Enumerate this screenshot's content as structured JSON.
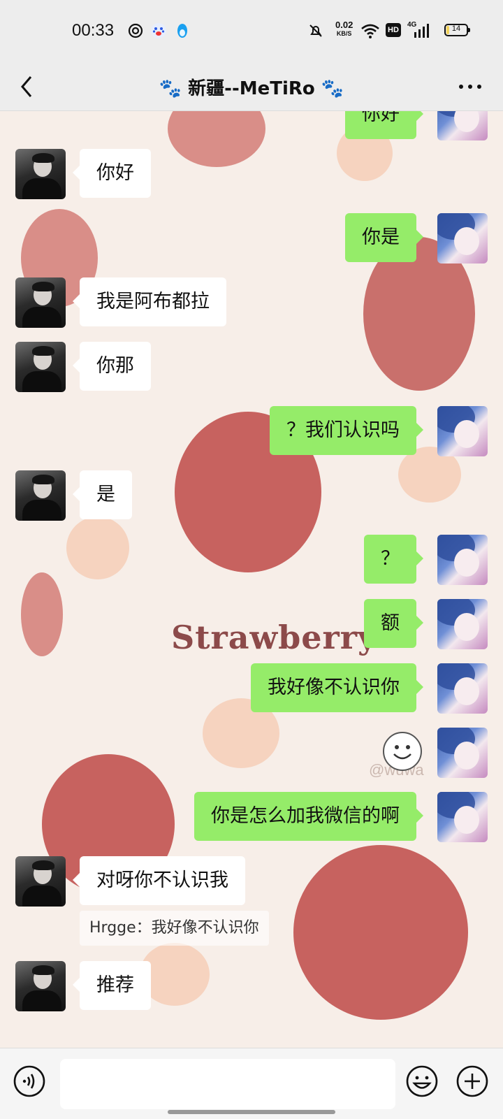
{
  "status_bar": {
    "time": "00:33",
    "net_speed_value": "0.02",
    "net_speed_unit": "KB/S",
    "hd_label": "HD",
    "signal_label": "4G",
    "battery_level": "14"
  },
  "header": {
    "title": "🐾 新疆--MeTiRo 🐾"
  },
  "background": {
    "strawberry_text": "Strawberry",
    "watermark": "@wuwa"
  },
  "messages": [
    {
      "side": "out",
      "text": "你好"
    },
    {
      "side": "in",
      "text": "你好"
    },
    {
      "side": "out",
      "text": "你是"
    },
    {
      "side": "in",
      "text": "我是阿布都拉"
    },
    {
      "side": "in",
      "text": "你那"
    },
    {
      "side": "out",
      "text": "？我们认识吗"
    },
    {
      "side": "in",
      "text": "是"
    },
    {
      "side": "out",
      "text": "？"
    },
    {
      "side": "out",
      "text": "额"
    },
    {
      "side": "out",
      "text": "我好像不认识你"
    },
    {
      "side": "out",
      "text": "",
      "sticker": "smile-face-sticker"
    },
    {
      "side": "out",
      "text": "你是怎么加我微信的啊"
    },
    {
      "side": "in",
      "text": "对呀你不认识我",
      "quote": "Hrgge：我好像不认识你"
    },
    {
      "side": "in",
      "text": "推荐"
    }
  ],
  "input_bar": {
    "placeholder": "",
    "icons": [
      "voice-icon",
      "emoji-icon",
      "plus-icon"
    ]
  },
  "colors": {
    "out_bubble": "#95ec69",
    "in_bubble": "#ffffff",
    "chrome_bg": "#ededed"
  }
}
